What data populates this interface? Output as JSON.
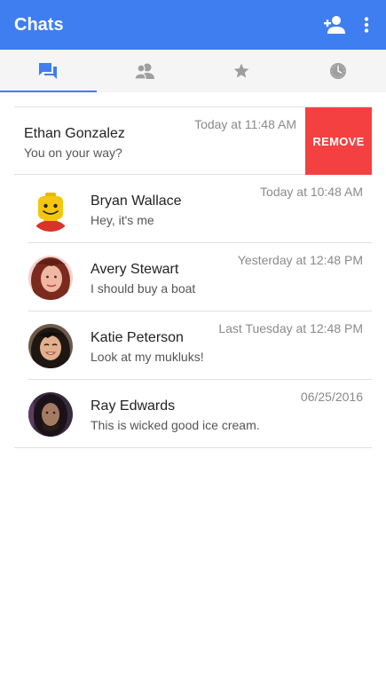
{
  "appbar": {
    "title": "Chats",
    "icons": [
      "person-add-icon",
      "more-vert-icon"
    ]
  },
  "tabs": [
    {
      "icon": "chat-icon",
      "active": true
    },
    {
      "icon": "contacts-icon",
      "active": false
    },
    {
      "icon": "star-icon",
      "active": false
    },
    {
      "icon": "clock-icon",
      "active": false
    }
  ],
  "colors": {
    "primary": "#3f7ef0",
    "remove": "#f44040"
  },
  "chats": [
    {
      "name": "Ethan Gonzalez",
      "message": "You on your way?",
      "time": "Today at 11:48 AM",
      "action": "REMOVE"
    },
    {
      "name": "Bryan Wallace",
      "message": "Hey, it's me",
      "time": "Today at 10:48 AM"
    },
    {
      "name": "Avery Stewart",
      "message": "I should buy a boat",
      "time": "Yesterday at 12:48 PM"
    },
    {
      "name": "Katie Peterson",
      "message": "Look at my mukluks!",
      "time": "Last Tuesday at 12:48 PM"
    },
    {
      "name": "Ray Edwards",
      "message": "This is wicked good ice cream.",
      "time": "06/25/2016"
    }
  ]
}
